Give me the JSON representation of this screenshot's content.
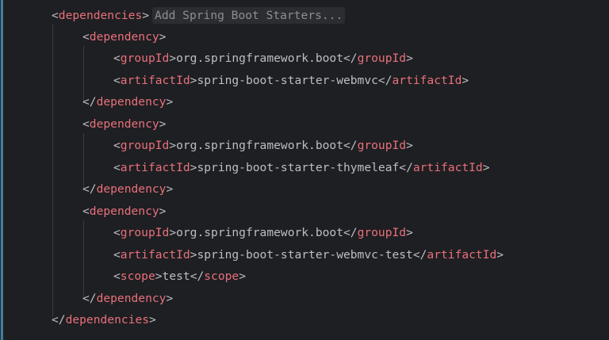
{
  "editor": {
    "inlay_hint": "Add Spring Boot Starters...",
    "lines": [
      {
        "open": "<",
        "tag": "dependencies",
        "close": ">",
        "hint": true
      },
      {
        "open": "<",
        "tag": "dependency",
        "close": ">"
      },
      {
        "open": "<",
        "tag": "groupId",
        "close": ">",
        "text": "org.springframework.boot",
        "open2": "</",
        "tag2": "groupId",
        "close2": ">"
      },
      {
        "open": "<",
        "tag": "artifactId",
        "close": ">",
        "text": "spring-boot-starter-webmvc",
        "open2": "</",
        "tag2": "artifactId",
        "close2": ">"
      },
      {
        "open": "</",
        "tag": "dependency",
        "close": ">"
      },
      {
        "open": "<",
        "tag": "dependency",
        "close": ">"
      },
      {
        "open": "<",
        "tag": "groupId",
        "close": ">",
        "text": "org.springframework.boot",
        "open2": "</",
        "tag2": "groupId",
        "close2": ">"
      },
      {
        "open": "<",
        "tag": "artifactId",
        "close": ">",
        "text": "spring-boot-starter-thymeleaf",
        "open2": "</",
        "tag2": "artifactId",
        "close2": ">"
      },
      {
        "open": "</",
        "tag": "dependency",
        "close": ">"
      },
      {
        "open": "<",
        "tag": "dependency",
        "close": ">"
      },
      {
        "open": "<",
        "tag": "groupId",
        "close": ">",
        "text": "org.springframework.boot",
        "open2": "</",
        "tag2": "groupId",
        "close2": ">"
      },
      {
        "open": "<",
        "tag": "artifactId",
        "close": ">",
        "text": "spring-boot-starter-webmvc-test",
        "open2": "</",
        "tag2": "artifactId",
        "close2": ">"
      },
      {
        "open": "<",
        "tag": "scope",
        "close": ">",
        "text": "test",
        "open2": "</",
        "tag2": "scope",
        "close2": ">"
      },
      {
        "open": "</",
        "tag": "dependency",
        "close": ">"
      },
      {
        "open": "</",
        "tag": "dependencies",
        "close": ">"
      }
    ]
  },
  "colors": {
    "background": "#1e1f22",
    "tag": "#e8707c",
    "text": "#bcbec4",
    "hint_text": "#8c8f94",
    "change_bar": "#3f7fa1"
  }
}
